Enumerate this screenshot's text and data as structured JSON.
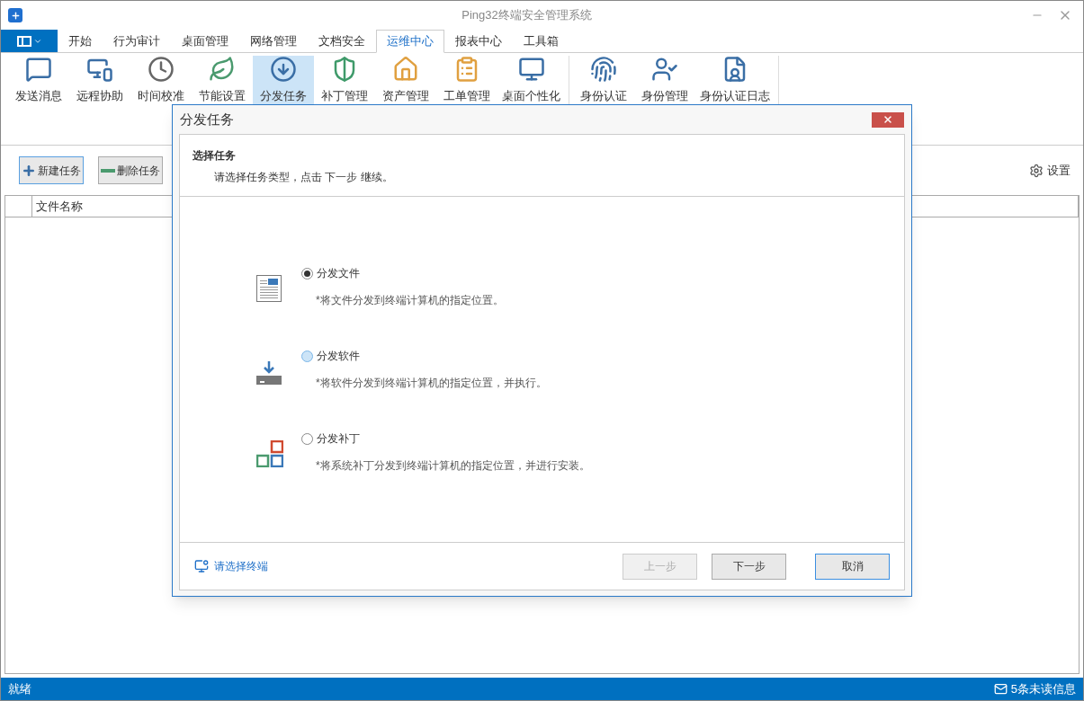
{
  "window": {
    "title": "Ping32终端安全管理系统"
  },
  "tabs": [
    {
      "label": "开始",
      "selected": false
    },
    {
      "label": "行为审计",
      "selected": false
    },
    {
      "label": "桌面管理",
      "selected": false
    },
    {
      "label": "网络管理",
      "selected": false
    },
    {
      "label": "文档安全",
      "selected": false
    },
    {
      "label": "运维中心",
      "selected": true
    },
    {
      "label": "报表中心",
      "selected": false
    },
    {
      "label": "工具箱",
      "selected": false
    }
  ],
  "ribbon": {
    "groups": [
      {
        "items": [
          {
            "label": "发送消息",
            "selected": false
          },
          {
            "label": "远程协助",
            "selected": false
          },
          {
            "label": "时间校准",
            "selected": false
          },
          {
            "label": "节能设置",
            "selected": false
          },
          {
            "label": "分发任务",
            "selected": true
          },
          {
            "label": "补丁管理",
            "selected": false
          },
          {
            "label": "资产管理",
            "selected": false
          },
          {
            "label": "工单管理",
            "selected": false
          },
          {
            "label": "桌面个性化",
            "selected": false
          }
        ]
      },
      {
        "items": [
          {
            "label": "身份认证",
            "selected": false
          },
          {
            "label": "身份管理",
            "selected": false
          },
          {
            "label": "身份认证日志",
            "selected": false
          }
        ]
      }
    ]
  },
  "toolbar": {
    "buttons": [
      {
        "label": "新建任务",
        "focused": true
      },
      {
        "label": "删除任务",
        "focused": false
      }
    ],
    "settings": "设置"
  },
  "table": {
    "columns": [
      "",
      "文件名称"
    ]
  },
  "dialog": {
    "title": "分发任务",
    "heading": "选择任务",
    "instruction": "请选择任务类型，点击 下一步 继续。",
    "options": [
      {
        "label": "分发文件",
        "description": "*将文件分发到终端计算机的指定位置。",
        "selected": true,
        "hovered": false
      },
      {
        "label": "分发软件",
        "description": "*将软件分发到终端计算机的指定位置，并执行。",
        "selected": false,
        "hovered": true
      },
      {
        "label": "分发补丁",
        "description": "*将系统补丁分发到终端计算机的指定位置，并进行安装。",
        "selected": false,
        "hovered": false
      }
    ],
    "link": "请选择终端",
    "buttons": [
      {
        "label": "上一步",
        "disabled": true,
        "focused": false
      },
      {
        "label": "下一步",
        "disabled": false,
        "focused": false
      },
      {
        "label": "取消",
        "disabled": false,
        "focused": true
      }
    ]
  },
  "status_bar": {
    "left": "就绪",
    "right": "5条未读信息"
  }
}
